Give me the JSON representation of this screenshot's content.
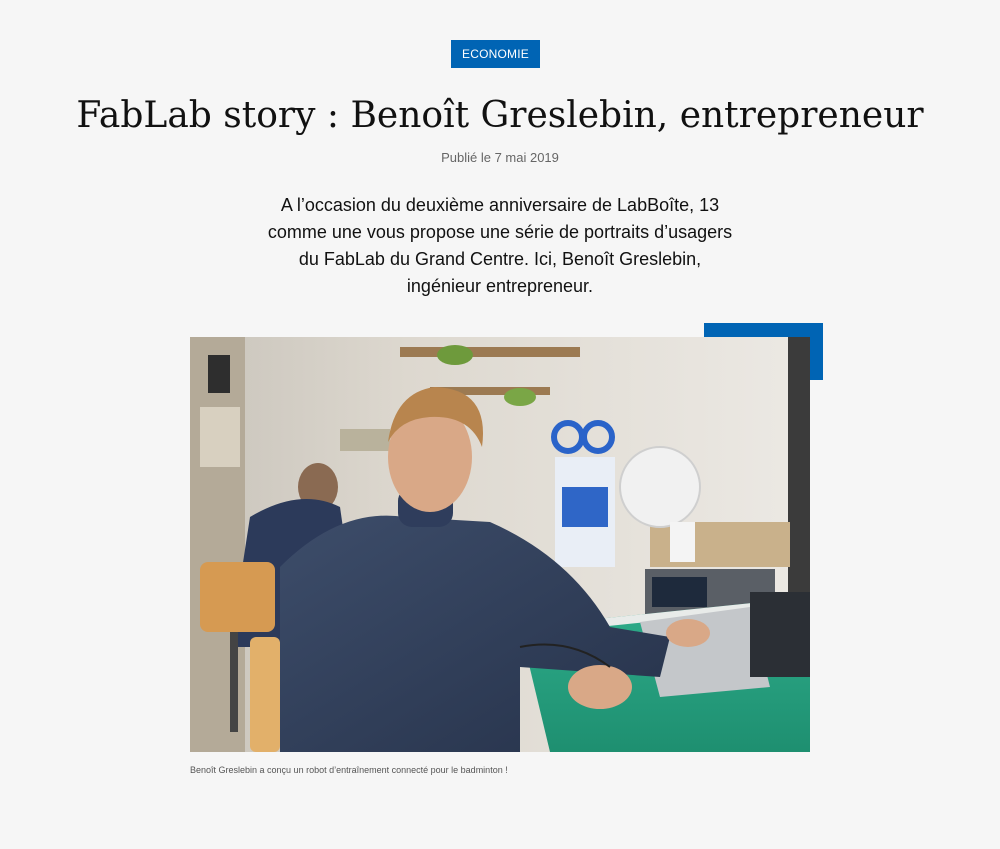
{
  "article": {
    "category": "ECONOMIE",
    "title": "FabLab story : Benoît Greslebin, entrepreneur",
    "published": "Publié le 7 mai 2019",
    "lead": "A l’occasion du deuxième anniversaire de LabBoîte, 13 comme une vous propose une série de portraits d’usagers du FabLab du Grand Centre. Ici, Benoît Greslebin, ingénieur entrepreneur.",
    "image_caption": "Benoît Greslebin a conçu un robot d’entraînement connecté pour le badminton !"
  },
  "colors": {
    "accent": "#0064b4",
    "background": "#f6f6f6"
  }
}
